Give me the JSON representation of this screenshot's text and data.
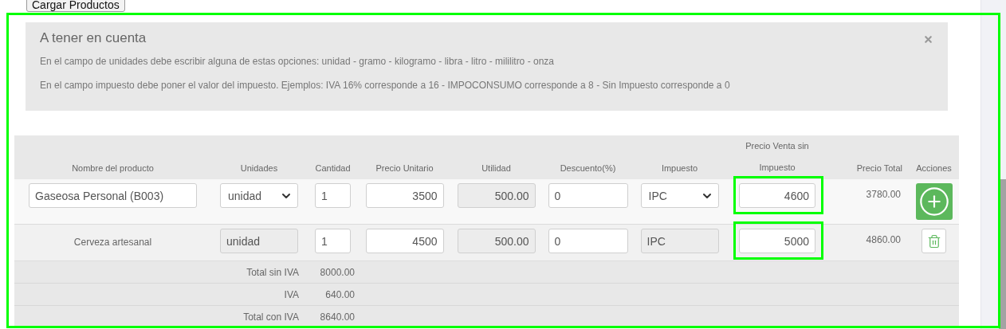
{
  "top_button": "Cargar Productos",
  "notice": {
    "title": "A tener en cuenta",
    "lines": [
      "En el campo de unidades debe escribir alguna de estas opciones: unidad - gramo - kilogramo - libra - litro - mililitro - onza",
      "En el campo impuesto debe poner el valor del impuesto. Ejemplos: IVA 16% corresponde a 16 - IMPOCONSUMO corresponde a 8 - Sin Impuesto corresponde a 0"
    ]
  },
  "table": {
    "columns": [
      "Nombre del producto",
      "Unidades",
      "Cantidad",
      "Precio Unitario",
      "Utilidad",
      "Descuento(%)",
      "Impuesto",
      "Precio Venta sin Impuesto",
      "Precio Total",
      "Acciones"
    ],
    "rows": [
      {
        "kind": "editable",
        "name": "Gaseosa Personal (B003)",
        "unit": "unidad",
        "quantity": "1",
        "unit_price": "3500",
        "utility": "500.00",
        "discount": "0",
        "tax": "IPC",
        "sale_price": "4600",
        "highlighted": true,
        "total": "3780.00",
        "action": {
          "kind": "add"
        }
      },
      {
        "kind": "saved",
        "name": "Cerveza artesanal",
        "unit": "unidad",
        "quantity": "1",
        "unit_price": "4500",
        "utility": "500.00",
        "discount": "0",
        "tax": "IPC",
        "sale_price": "5000",
        "highlighted": true,
        "total": "4860.00",
        "action": {
          "kind": "delete"
        }
      }
    ],
    "totals": [
      {
        "label": "Total sin IVA",
        "value": "8000.00"
      },
      {
        "label": "IVA",
        "value": "640.00"
      },
      {
        "label": "Total con IVA",
        "value": "8640.00"
      }
    ]
  },
  "annotation_frame": true
}
